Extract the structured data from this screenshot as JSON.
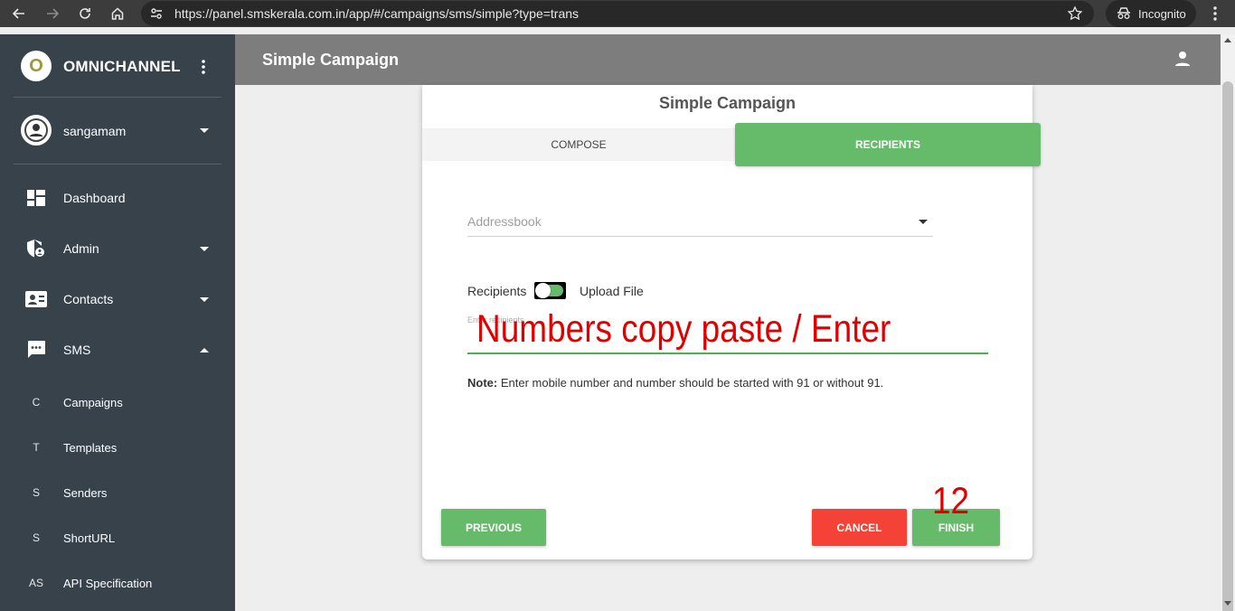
{
  "browser": {
    "url": "https://panel.smskerala.com.in/app/#/campaigns/sms/simple?type=trans",
    "incognito_label": "Incognito"
  },
  "sidebar": {
    "brand_letter": "O",
    "brand_name": "OMNICHANNEL",
    "username": "sangamam",
    "nav": [
      {
        "label": "Dashboard",
        "icon": "dashboard-icon"
      },
      {
        "label": "Admin",
        "icon": "admin-shield-icon"
      },
      {
        "label": "Contacts",
        "icon": "contacts-card-icon"
      },
      {
        "label": "SMS",
        "icon": "sms-chat-icon"
      }
    ],
    "sms_sub": [
      {
        "abbr": "C",
        "label": "Campaigns"
      },
      {
        "abbr": "T",
        "label": "Templates"
      },
      {
        "abbr": "S",
        "label": "Senders"
      },
      {
        "abbr": "S",
        "label": "ShortURL"
      },
      {
        "abbr": "AS",
        "label": "API Specification"
      }
    ]
  },
  "appbar": {
    "title": "Simple Campaign"
  },
  "card": {
    "title": "Simple Campaign",
    "tabs": {
      "compose": "COMPOSE",
      "recipients": "RECIPIENTS"
    },
    "addressbook_placeholder": "Addressbook",
    "toggle_left": "Recipients",
    "toggle_right": "Upload File",
    "recipients_placeholder": "Enter recipients",
    "annotation_text": "Numbers copy paste / Enter",
    "note_label": "Note:",
    "note_text": " Enter mobile number and number should be started with 91 or without 91.",
    "buttons": {
      "previous": "PREVIOUS",
      "cancel": "CANCEL",
      "finish": "FINISH"
    },
    "annotation_number": "12"
  },
  "colors": {
    "green": "#66bb6a",
    "red": "#f44336",
    "sidebar": "#37424b",
    "appbar": "#7d7d7d"
  }
}
